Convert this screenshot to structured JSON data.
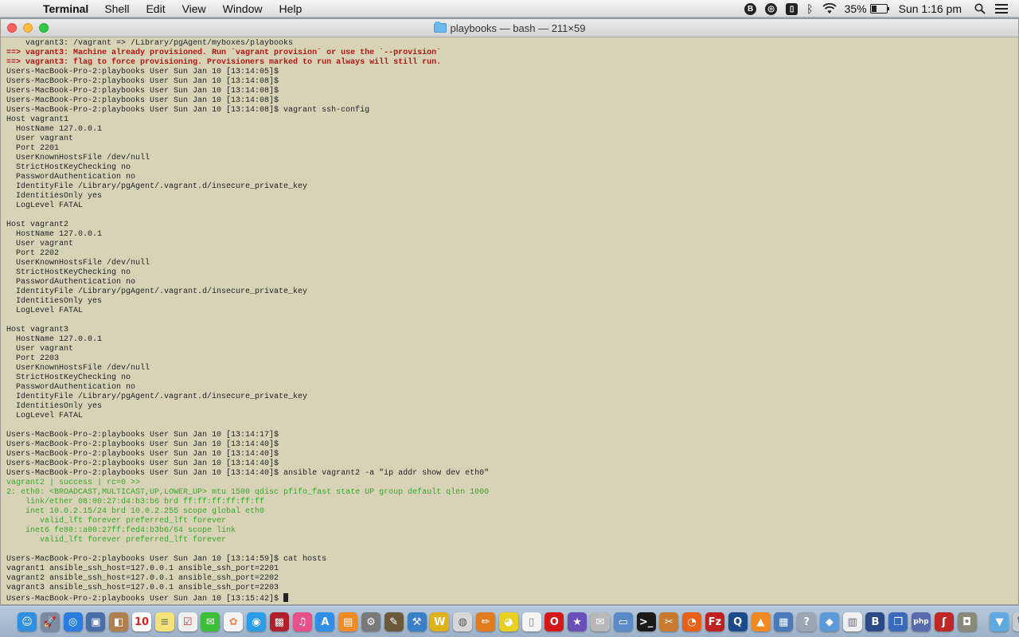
{
  "menubar": {
    "apple": "",
    "app_name": "Terminal",
    "menus": [
      "Shell",
      "Edit",
      "View",
      "Window",
      "Help"
    ],
    "status": {
      "battery_percent_label": "35%",
      "battery_level": 0.35,
      "clock": "Sun 1:16 pm"
    }
  },
  "window": {
    "title": "playbooks — bash — 211×59"
  },
  "terminal": {
    "lines": [
      {
        "t": "    vagrant3: /vagrant => /Library/pgAgent/myboxes/playbooks",
        "s": "normal"
      },
      {
        "t": "==> vagrant3: Machine already provisioned. Run `vagrant provision` or use the `--provision`",
        "s": "warn"
      },
      {
        "t": "==> vagrant3: flag to force provisioning. Provisioners marked to run always will still run.",
        "s": "warn"
      },
      {
        "t": "Users-MacBook-Pro-2:playbooks User Sun Jan 10 [13:14:05]$",
        "s": "normal"
      },
      {
        "t": "Users-MacBook-Pro-2:playbooks User Sun Jan 10 [13:14:08]$",
        "s": "normal"
      },
      {
        "t": "Users-MacBook-Pro-2:playbooks User Sun Jan 10 [13:14:08]$",
        "s": "normal"
      },
      {
        "t": "Users-MacBook-Pro-2:playbooks User Sun Jan 10 [13:14:08]$",
        "s": "normal"
      },
      {
        "t": "Users-MacBook-Pro-2:playbooks User Sun Jan 10 [13:14:08]$ vagrant ssh-config",
        "s": "normal"
      },
      {
        "t": "Host vagrant1",
        "s": "normal"
      },
      {
        "t": "  HostName 127.0.0.1",
        "s": "normal"
      },
      {
        "t": "  User vagrant",
        "s": "normal"
      },
      {
        "t": "  Port 2201",
        "s": "normal"
      },
      {
        "t": "  UserKnownHostsFile /dev/null",
        "s": "normal"
      },
      {
        "t": "  StrictHostKeyChecking no",
        "s": "normal"
      },
      {
        "t": "  PasswordAuthentication no",
        "s": "normal"
      },
      {
        "t": "  IdentityFile /Library/pgAgent/.vagrant.d/insecure_private_key",
        "s": "normal"
      },
      {
        "t": "  IdentitiesOnly yes",
        "s": "normal"
      },
      {
        "t": "  LogLevel FATAL",
        "s": "normal"
      },
      {
        "t": "",
        "s": "normal"
      },
      {
        "t": "Host vagrant2",
        "s": "normal"
      },
      {
        "t": "  HostName 127.0.0.1",
        "s": "normal"
      },
      {
        "t": "  User vagrant",
        "s": "normal"
      },
      {
        "t": "  Port 2202",
        "s": "normal"
      },
      {
        "t": "  UserKnownHostsFile /dev/null",
        "s": "normal"
      },
      {
        "t": "  StrictHostKeyChecking no",
        "s": "normal"
      },
      {
        "t": "  PasswordAuthentication no",
        "s": "normal"
      },
      {
        "t": "  IdentityFile /Library/pgAgent/.vagrant.d/insecure_private_key",
        "s": "normal"
      },
      {
        "t": "  IdentitiesOnly yes",
        "s": "normal"
      },
      {
        "t": "  LogLevel FATAL",
        "s": "normal"
      },
      {
        "t": "",
        "s": "normal"
      },
      {
        "t": "Host vagrant3",
        "s": "normal"
      },
      {
        "t": "  HostName 127.0.0.1",
        "s": "normal"
      },
      {
        "t": "  User vagrant",
        "s": "normal"
      },
      {
        "t": "  Port 2203",
        "s": "normal"
      },
      {
        "t": "  UserKnownHostsFile /dev/null",
        "s": "normal"
      },
      {
        "t": "  StrictHostKeyChecking no",
        "s": "normal"
      },
      {
        "t": "  PasswordAuthentication no",
        "s": "normal"
      },
      {
        "t": "  IdentityFile /Library/pgAgent/.vagrant.d/insecure_private_key",
        "s": "normal"
      },
      {
        "t": "  IdentitiesOnly yes",
        "s": "normal"
      },
      {
        "t": "  LogLevel FATAL",
        "s": "normal"
      },
      {
        "t": "",
        "s": "normal"
      },
      {
        "t": "Users-MacBook-Pro-2:playbooks User Sun Jan 10 [13:14:17]$",
        "s": "normal"
      },
      {
        "t": "Users-MacBook-Pro-2:playbooks User Sun Jan 10 [13:14:40]$",
        "s": "normal"
      },
      {
        "t": "Users-MacBook-Pro-2:playbooks User Sun Jan 10 [13:14:40]$",
        "s": "normal"
      },
      {
        "t": "Users-MacBook-Pro-2:playbooks User Sun Jan 10 [13:14:40]$",
        "s": "normal"
      },
      {
        "t": "Users-MacBook-Pro-2:playbooks User Sun Jan 10 [13:14:40]$ ansible vagrant2 -a \"ip addr show dev eth0\"",
        "s": "normal"
      },
      {
        "t": "vagrant2 | success | rc=0 >>",
        "s": "ok"
      },
      {
        "t": "2: eth0: <BROADCAST,MULTICAST,UP,LOWER_UP> mtu 1500 qdisc pfifo_fast state UP group default qlen 1000",
        "s": "ok"
      },
      {
        "t": "    link/ether 08:00:27:d4:b3:b6 brd ff:ff:ff:ff:ff:ff",
        "s": "ok"
      },
      {
        "t": "    inet 10.0.2.15/24 brd 10.0.2.255 scope global eth0",
        "s": "ok"
      },
      {
        "t": "       valid_lft forever preferred_lft forever",
        "s": "ok"
      },
      {
        "t": "    inet6 fe80::a00:27ff:fed4:b3b6/64 scope link",
        "s": "ok"
      },
      {
        "t": "       valid_lft forever preferred_lft forever",
        "s": "ok"
      },
      {
        "t": "",
        "s": "normal"
      },
      {
        "t": "Users-MacBook-Pro-2:playbooks User Sun Jan 10 [13:14:59]$ cat hosts",
        "s": "normal"
      },
      {
        "t": "vagrant1 ansible_ssh_host=127.0.0.1 ansible_ssh_port=2201",
        "s": "normal"
      },
      {
        "t": "vagrant2 ansible_ssh_host=127.0.0.1 ansible_ssh_port=2202",
        "s": "normal"
      },
      {
        "t": "vagrant3 ansible_ssh_host=127.0.0.1 ansible_ssh_port=2203",
        "s": "normal"
      },
      {
        "t": "Users-MacBook-Pro-2:playbooks User Sun Jan 10 [13:15:42]$ ",
        "s": "prompt"
      }
    ]
  },
  "dock": {
    "items": [
      {
        "icon": "finder-icon",
        "glyph": "☺",
        "color": "#2f8fe0"
      },
      {
        "icon": "launchpad-icon",
        "glyph": "🚀",
        "color": "#7e8aa0"
      },
      {
        "icon": "safari-icon",
        "glyph": "◎",
        "color": "#2a7ce0"
      },
      {
        "icon": "preview-icon",
        "glyph": "▣",
        "color": "#4a6fa8"
      },
      {
        "icon": "contacts-icon",
        "glyph": "◧",
        "color": "#b08050"
      },
      {
        "icon": "calendar-icon",
        "glyph": "10",
        "color": "#ffffff",
        "fg": "#d22"
      },
      {
        "icon": "notes-icon",
        "glyph": "≡",
        "color": "#f5e27a",
        "fg": "#886"
      },
      {
        "icon": "reminders-icon",
        "glyph": "☑",
        "color": "#f0f0f0",
        "fg": "#c33"
      },
      {
        "icon": "messages-icon",
        "glyph": "✉",
        "color": "#3bbf3b"
      },
      {
        "icon": "photos-icon",
        "glyph": "✿",
        "color": "#f4f4f4",
        "fg": "#e85"
      },
      {
        "icon": "facetime-icon",
        "glyph": "◉",
        "color": "#2b9de8"
      },
      {
        "icon": "photo-booth-icon",
        "glyph": "▩",
        "color": "#b0202a"
      },
      {
        "icon": "itunes-icon",
        "glyph": "♫",
        "color": "#e8508a"
      },
      {
        "icon": "app-store-icon",
        "glyph": "A",
        "color": "#2f8ee8"
      },
      {
        "icon": "ibooks-icon",
        "glyph": "▤",
        "color": "#f08a24"
      },
      {
        "icon": "system-preferences-icon",
        "glyph": "⚙",
        "color": "#7a7a7a"
      },
      {
        "icon": "gimp-icon",
        "glyph": "✎",
        "color": "#6a5a3a"
      },
      {
        "icon": "xcode-icon",
        "glyph": "⚒",
        "color": "#3a80c8"
      },
      {
        "icon": "textwrangler-icon",
        "glyph": "W",
        "color": "#e0b21a"
      },
      {
        "icon": "disk-utility-icon",
        "glyph": "◍",
        "color": "#d8d8d8",
        "fg": "#555"
      },
      {
        "icon": "paint-icon",
        "glyph": "✏",
        "color": "#e07b20"
      },
      {
        "icon": "chrome-icon",
        "glyph": "◕",
        "color": "#e8d020"
      },
      {
        "icon": "document-icon",
        "glyph": "▯",
        "color": "#f4f4f4",
        "fg": "#888"
      },
      {
        "icon": "opera-icon",
        "glyph": "O",
        "color": "#d41818"
      },
      {
        "icon": "star-app-icon",
        "glyph": "★",
        "color": "#6a4fb8"
      },
      {
        "icon": "mail-app-icon",
        "glyph": "✉",
        "color": "#b8b8b8"
      },
      {
        "icon": "screen-icon",
        "glyph": "▭",
        "color": "#5a8ac8"
      },
      {
        "icon": "terminal-icon",
        "glyph": ">_",
        "color": "#1a1a1a"
      },
      {
        "icon": "tools-icon",
        "glyph": "✂",
        "color": "#c87a30"
      },
      {
        "icon": "firefox-icon",
        "glyph": "◔",
        "color": "#e8601a"
      },
      {
        "icon": "filezilla-icon",
        "glyph": "Fz",
        "color": "#c02020"
      },
      {
        "icon": "quicktime-icon",
        "glyph": "Q",
        "color": "#1a4a8a"
      },
      {
        "icon": "vlc-icon",
        "glyph": "▲",
        "color": "#f08a20"
      },
      {
        "icon": "display-icon",
        "glyph": "▦",
        "color": "#4a78b8"
      },
      {
        "icon": "help-icon",
        "glyph": "?",
        "color": "#9aa6b4"
      },
      {
        "icon": "box-icon",
        "glyph": "◆",
        "color": "#5a9ad8"
      },
      {
        "icon": "stickies-icon",
        "glyph": "▥",
        "color": "#f0f0f0",
        "fg": "#668"
      },
      {
        "icon": "bbedit-icon",
        "glyph": "B",
        "color": "#2a4a8a"
      },
      {
        "icon": "virtualbox-icon",
        "glyph": "❒",
        "color": "#3a6ab8"
      },
      {
        "icon": "php-icon",
        "glyph": "php",
        "color": "#5a6ab0"
      },
      {
        "icon": "flash-icon",
        "glyph": "ʃ",
        "color": "#c02828"
      },
      {
        "icon": "jar-icon",
        "glyph": "◘",
        "color": "#8a8a7a"
      }
    ],
    "trailing": [
      {
        "icon": "downloads-folder-icon",
        "glyph": "▼",
        "color": "#5fa8e0"
      },
      {
        "icon": "trash-icon",
        "glyph": "🗑",
        "color": "#c8ccd2",
        "fg": "#666"
      }
    ]
  }
}
